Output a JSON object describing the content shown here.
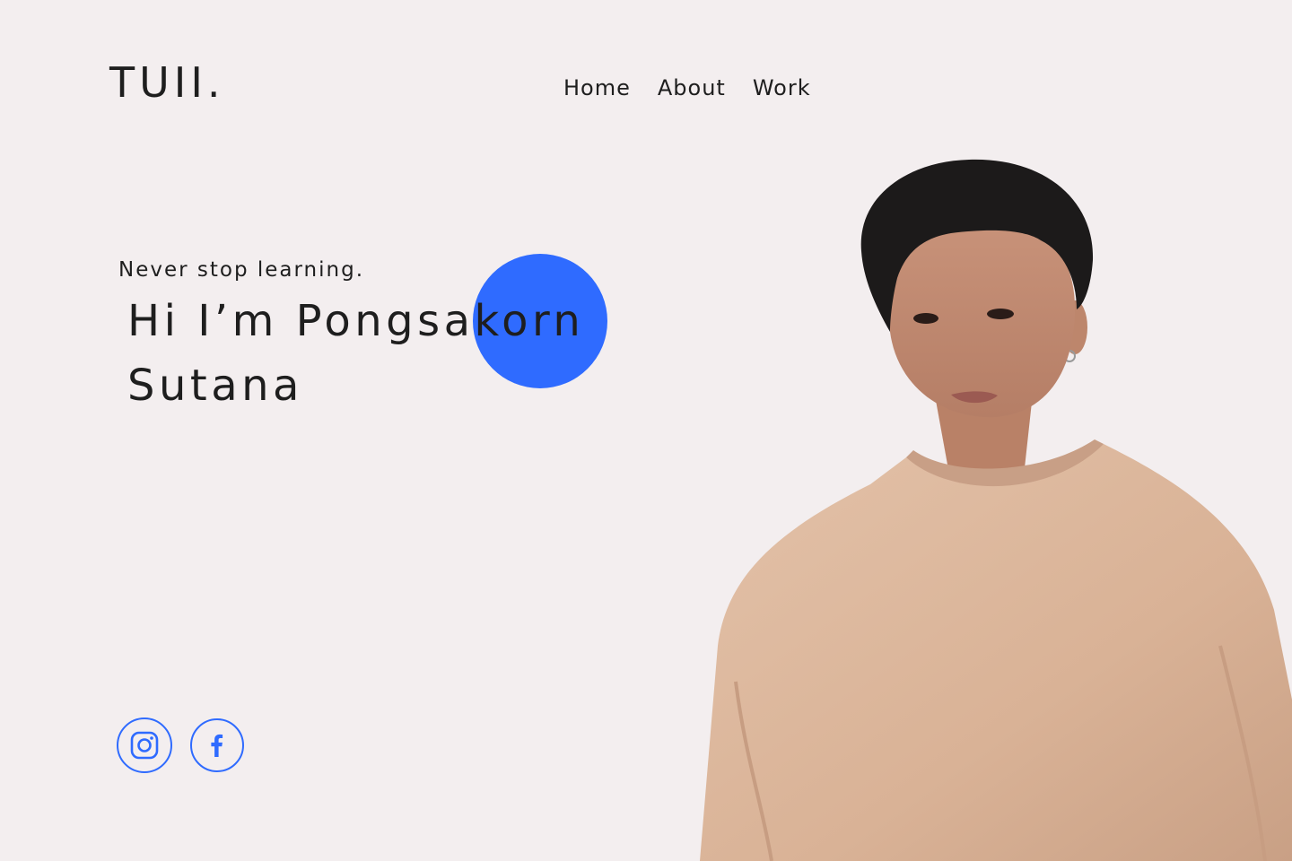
{
  "header": {
    "logo": "TUII.",
    "nav": [
      {
        "label": "Home"
      },
      {
        "label": "About"
      },
      {
        "label": "Work"
      }
    ]
  },
  "hero": {
    "tagline": "Never stop learning.",
    "headline_line1": "Hi I’m Pongsakorn",
    "headline_line2": "Sutana",
    "accent_color": "#2F6BFF"
  },
  "socials": [
    {
      "icon": "instagram-icon"
    },
    {
      "icon": "facebook-icon"
    }
  ],
  "portrait": {
    "sweater_color": "#DDB89F",
    "skin_color": "#C58E72",
    "hair_color": "#1C1A1A"
  }
}
